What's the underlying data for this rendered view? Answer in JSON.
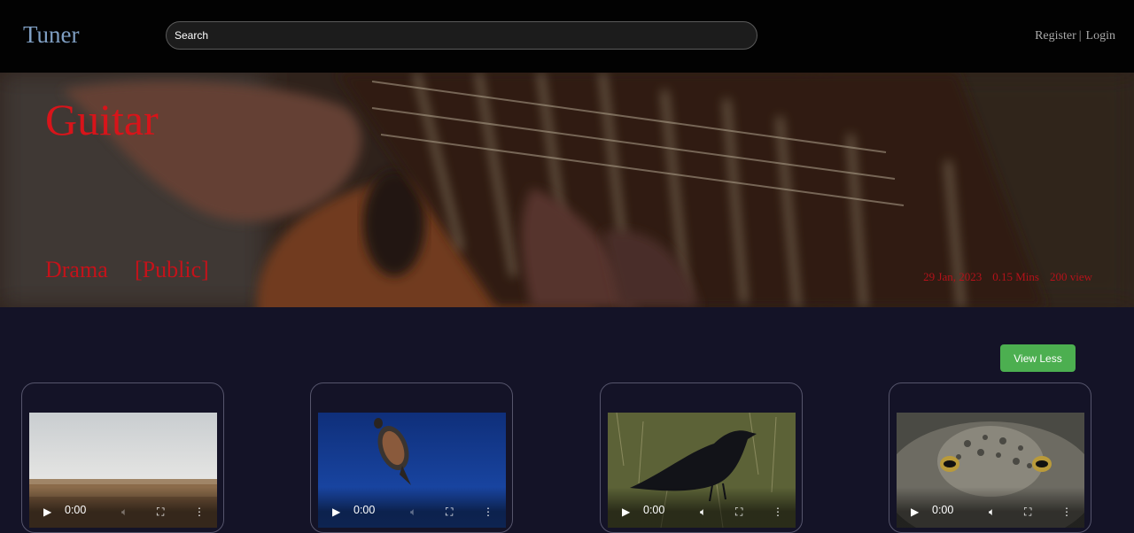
{
  "app": {
    "name": "Tuner"
  },
  "header": {
    "search_placeholder": "Search",
    "register_label": "Register",
    "separator": "|",
    "login_label": "Login"
  },
  "hero": {
    "title": "Guitar",
    "genre": "Drama",
    "visibility": "[Public]",
    "date": "29 Jan, 2023",
    "duration": "0.15 Mins",
    "views": "200 view"
  },
  "content": {
    "toggle_label": "View Less",
    "videos": [
      {
        "thumbnail": "desert-landscape",
        "time": "0:00",
        "muted_disabled": true
      },
      {
        "thumbnail": "sea-turtle-underwater",
        "time": "0:00",
        "muted_disabled": true
      },
      {
        "thumbnail": "crow-on-grass",
        "time": "0:00",
        "muted_disabled": false
      },
      {
        "thumbnail": "toad-closeup",
        "time": "0:00",
        "muted_disabled": false
      }
    ]
  },
  "colors": {
    "header_bg": "#020202",
    "page_bg": "#141327",
    "logo": "#7f9fc3",
    "hero_text": "#d8141a",
    "button": "#4caf50"
  },
  "icons": {
    "play": "play-icon",
    "volume": "volume-icon",
    "fullscreen": "fullscreen-icon",
    "more": "more-options-icon"
  }
}
